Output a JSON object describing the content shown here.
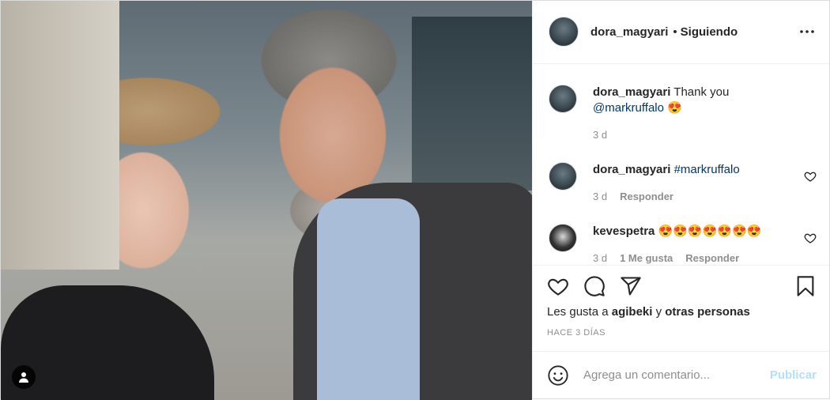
{
  "header": {
    "username": "dora_magyari",
    "separator": "•",
    "follow_status": "Siguiendo",
    "more_icon": "more-horizontal-icon"
  },
  "comments": [
    {
      "username": "dora_magyari",
      "text": "Thank you",
      "mention": "@markruffalo",
      "emoji": "😍",
      "time": "3 d",
      "reply": "",
      "likes": ""
    },
    {
      "username": "dora_magyari",
      "text": "",
      "mention": "#markruffalo",
      "emoji": "",
      "time": "3 d",
      "reply": "Responder",
      "likes": ""
    },
    {
      "username": "kevespetra",
      "text": "😍😍😍😍😍😍😍",
      "mention": "",
      "emoji": "",
      "time": "3 d",
      "reply": "Responder",
      "likes": "1 Me gusta"
    }
  ],
  "actions": {
    "like_icon": "heart-icon",
    "comment_icon": "comment-icon",
    "share_icon": "share-icon",
    "save_icon": "bookmark-icon"
  },
  "likes": {
    "prefix": "Les gusta a",
    "user": "agibeki",
    "joiner": "y",
    "others": "otras personas"
  },
  "date": "HACE 3 DÍAS",
  "add_comment": {
    "placeholder": "Agrega un comentario...",
    "publish": "Publicar",
    "emoji_icon": "smiley-icon"
  },
  "colors": {
    "link": "#00376b",
    "muted": "#8e8e8e",
    "publish_disabled": "#b2dffc"
  }
}
